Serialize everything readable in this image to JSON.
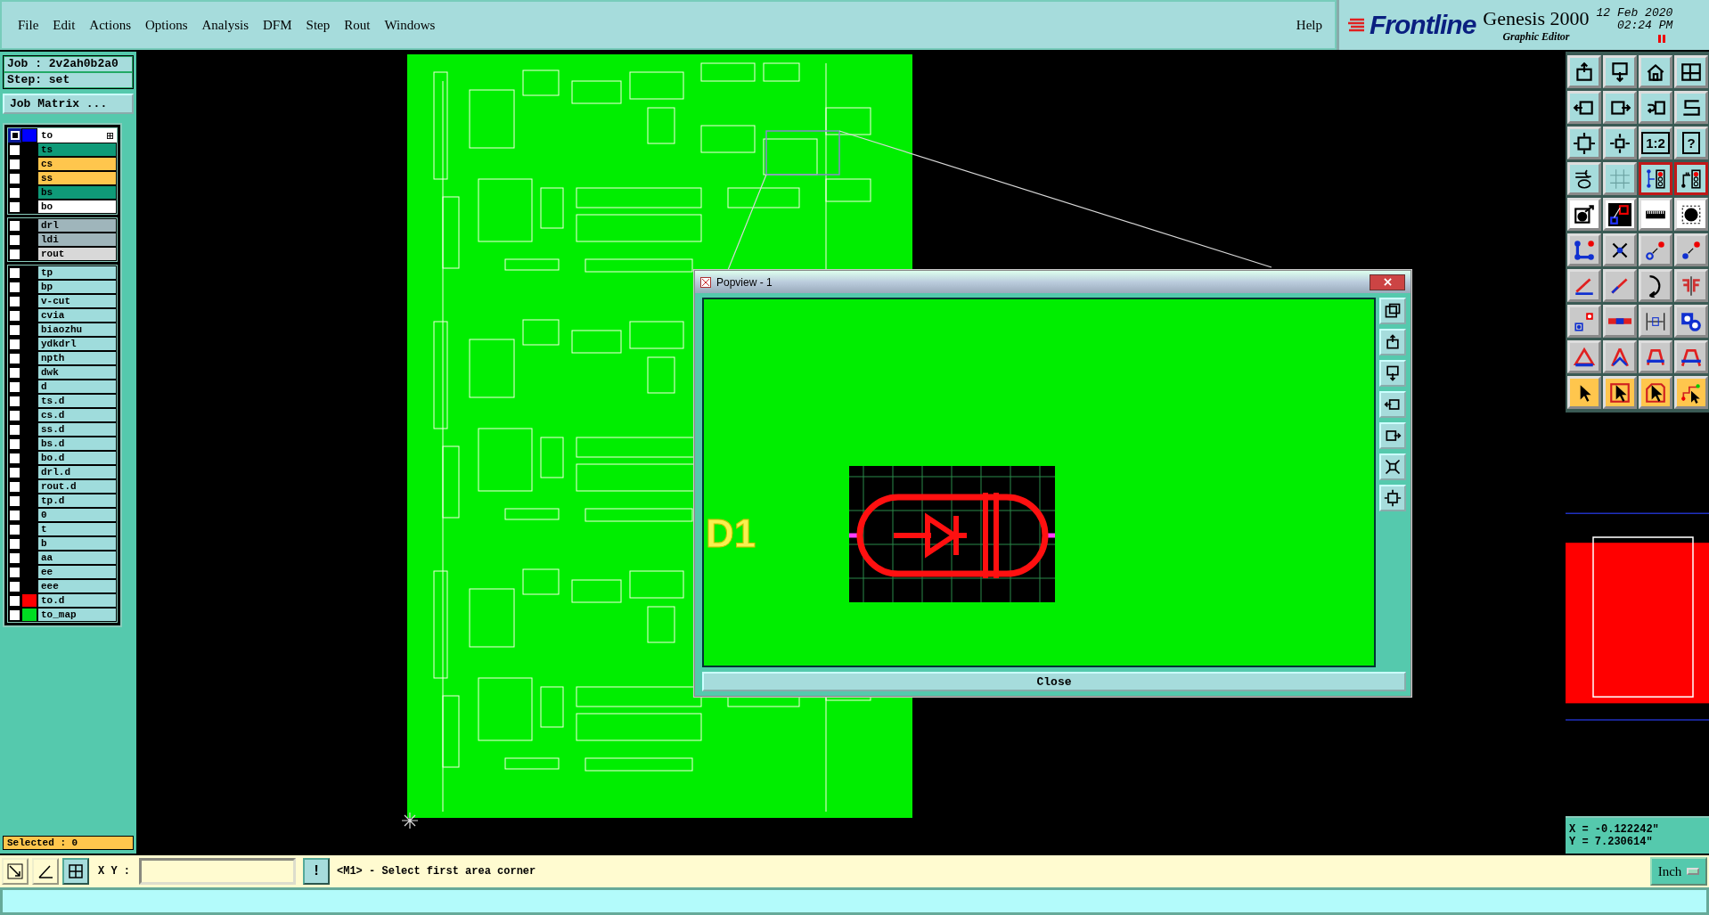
{
  "menu": {
    "items": [
      "File",
      "Edit",
      "Actions",
      "Options",
      "Analysis",
      "DFM",
      "Step",
      "Rout",
      "Windows"
    ],
    "help": "Help"
  },
  "brand": {
    "logo": "Frontline",
    "product": "Genesis 2000",
    "subtitle": "Graphic Editor",
    "date": "12 Feb 2020",
    "time": "02:24 PM"
  },
  "job": {
    "job": "Job : 2v2ah0b2a0",
    "step": "Step: set",
    "matrix_button": "Job Matrix ..."
  },
  "layer_groups": [
    [
      {
        "name": "to",
        "kind": "signal",
        "selected": true,
        "color": "#0000ff"
      },
      {
        "name": "ts",
        "kind": "solder_mask",
        "selected": false
      },
      {
        "name": "cs",
        "kind": "silk_screen",
        "selected": false
      },
      {
        "name": "ss",
        "kind": "silk_screen",
        "selected": false
      },
      {
        "name": "bs",
        "kind": "solder_mask",
        "selected": false
      },
      {
        "name": "bo",
        "kind": "signal",
        "selected": false
      }
    ],
    [
      {
        "name": "drl",
        "kind": "drill",
        "selected": false
      },
      {
        "name": "ldi",
        "kind": "drill",
        "selected": false
      },
      {
        "name": "rout",
        "kind": "rout",
        "selected": false
      }
    ],
    [
      {
        "name": "tp",
        "kind": "misc",
        "selected": false
      },
      {
        "name": "bp",
        "kind": "misc",
        "selected": false
      },
      {
        "name": "v-cut",
        "kind": "misc",
        "selected": false
      },
      {
        "name": "cvia",
        "kind": "misc",
        "selected": false
      },
      {
        "name": "biaozhu",
        "kind": "misc",
        "selected": false
      },
      {
        "name": "ydkdrl",
        "kind": "misc",
        "selected": false
      },
      {
        "name": "npth",
        "kind": "misc",
        "selected": false
      },
      {
        "name": "dwk",
        "kind": "misc",
        "selected": false
      },
      {
        "name": "d",
        "kind": "misc",
        "selected": false
      },
      {
        "name": "ts.d",
        "kind": "misc",
        "selected": false
      },
      {
        "name": "cs.d",
        "kind": "misc",
        "selected": false
      },
      {
        "name": "ss.d",
        "kind": "misc",
        "selected": false
      },
      {
        "name": "bs.d",
        "kind": "misc",
        "selected": false
      },
      {
        "name": "bo.d",
        "kind": "misc",
        "selected": false
      },
      {
        "name": "drl.d",
        "kind": "misc",
        "selected": false
      },
      {
        "name": "rout.d",
        "kind": "misc",
        "selected": false
      },
      {
        "name": "tp.d",
        "kind": "misc",
        "selected": false
      },
      {
        "name": "0",
        "kind": "misc",
        "selected": false
      },
      {
        "name": "t",
        "kind": "misc",
        "selected": false
      },
      {
        "name": "b",
        "kind": "misc",
        "selected": false
      },
      {
        "name": "aa",
        "kind": "misc",
        "selected": false
      },
      {
        "name": "ee",
        "kind": "misc",
        "selected": false
      },
      {
        "name": "eee",
        "kind": "misc",
        "selected": false
      },
      {
        "name": "to.d",
        "kind": "misc",
        "selected": false,
        "color": "#ff0000"
      },
      {
        "name": "to_map",
        "kind": "misc",
        "selected": false,
        "color": "#00dd22"
      }
    ]
  ],
  "selected_count": "Selected : 0",
  "popview": {
    "title": "Popview - 1",
    "designator": "D1",
    "close_button": "Close"
  },
  "toolbar": [
    {
      "kind": "teal",
      "on": false
    },
    {
      "kind": "teal",
      "on": false
    },
    {
      "kind": "teal",
      "on": false
    },
    {
      "kind": "teal",
      "on": false
    },
    {
      "kind": "teal",
      "on": false
    },
    {
      "kind": "teal",
      "on": false
    },
    {
      "kind": "teal",
      "on": false
    },
    {
      "kind": "teal",
      "on": false
    },
    {
      "kind": "teal",
      "on": false
    },
    {
      "kind": "teal",
      "on": false
    },
    {
      "kind": "teal",
      "on": false,
      "label": "1:2"
    },
    {
      "kind": "teal",
      "on": false,
      "label": "?"
    },
    {
      "kind": "teal",
      "on": false
    },
    {
      "kind": "teal",
      "on": false
    },
    {
      "kind": "teal",
      "on": true
    },
    {
      "kind": "teal",
      "on": true
    },
    {
      "kind": "white",
      "on": false
    },
    {
      "kind": "white",
      "on": false
    },
    {
      "kind": "white",
      "on": false
    },
    {
      "kind": "white",
      "on": false
    },
    {
      "kind": "grey",
      "on": false
    },
    {
      "kind": "grey",
      "on": false
    },
    {
      "kind": "grey",
      "on": false
    },
    {
      "kind": "grey",
      "on": false
    },
    {
      "kind": "grey",
      "on": false
    },
    {
      "kind": "grey",
      "on": false
    },
    {
      "kind": "grey",
      "on": false
    },
    {
      "kind": "grey",
      "on": false
    },
    {
      "kind": "grey",
      "on": false
    },
    {
      "kind": "grey",
      "on": false
    },
    {
      "kind": "grey",
      "on": false
    },
    {
      "kind": "grey",
      "on": false
    },
    {
      "kind": "grey",
      "on": false
    },
    {
      "kind": "grey",
      "on": false
    },
    {
      "kind": "grey",
      "on": false
    },
    {
      "kind": "grey",
      "on": false
    },
    {
      "kind": "orange",
      "on": false
    },
    {
      "kind": "orange",
      "on": false
    },
    {
      "kind": "orange",
      "on": false
    },
    {
      "kind": "orange",
      "on": false
    }
  ],
  "coordinates": {
    "x": "X = -0.122242\"",
    "y": "Y = 7.230614\""
  },
  "command": {
    "xy_label": "X Y :",
    "action_button": "!",
    "message": "<M1> - Select first area corner",
    "units": "Inch"
  }
}
